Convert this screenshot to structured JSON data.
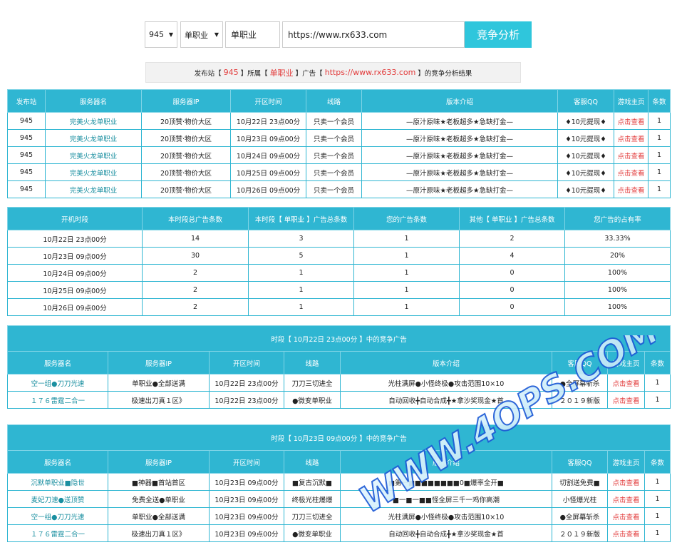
{
  "search": {
    "site_select": "945",
    "type_select": "单职业",
    "keyword": "单职业",
    "url": "https://www.rx633.com",
    "button": "竞争分析"
  },
  "summary": {
    "p1": "发布站【",
    "site": "945",
    "p2": "】所属【",
    "type": "单职业",
    "p3": "】广告【",
    "url": "https://www.rx633.com",
    "p4": "】的竞争分析结果"
  },
  "table1": {
    "headers": [
      "发布站",
      "服务器名",
      "服务器IP",
      "开区时间",
      "线路",
      "版本介绍",
      "客服QQ",
      "游戏主页",
      "条数"
    ],
    "rows": [
      [
        "945",
        "完美火龙单职业",
        "20顶赞·物价大区",
        "10月22日 23点00分",
        "只卖一个会员",
        "—原汁原味★老板超多★急缺打金—",
        "♦10元提现♦",
        "点击查看",
        "1"
      ],
      [
        "945",
        "完美火龙单职业",
        "20顶赞·物价大区",
        "10月23日 09点00分",
        "只卖一个会员",
        "—原汁原味★老板超多★急缺打金—",
        "♦10元提现♦",
        "点击查看",
        "1"
      ],
      [
        "945",
        "完美火龙单职业",
        "20顶赞·物价大区",
        "10月24日 09点00分",
        "只卖一个会员",
        "—原汁原味★老板超多★急缺打金—",
        "♦10元提现♦",
        "点击查看",
        "1"
      ],
      [
        "945",
        "完美火龙单职业",
        "20顶赞·物价大区",
        "10月25日 09点00分",
        "只卖一个会员",
        "—原汁原味★老板超多★急缺打金—",
        "♦10元提现♦",
        "点击查看",
        "1"
      ],
      [
        "945",
        "完美火龙单职业",
        "20顶赞·物价大区",
        "10月26日 09点00分",
        "只卖一个会员",
        "—原汁原味★老板超多★急缺打金—",
        "♦10元提现♦",
        "点击查看",
        "1"
      ]
    ]
  },
  "table2": {
    "headers": [
      "开机时段",
      "本时段总广告条数",
      "本时段【 单职业 】广告总条数",
      "您的广告条数",
      "其他【 单职业 】广告总条数",
      "您广告的占有率"
    ],
    "rows": [
      [
        "10月22日 23点00分",
        "14",
        "3",
        "1",
        "2",
        "33.33%"
      ],
      [
        "10月23日 09点00分",
        "30",
        "5",
        "1",
        "4",
        "20%"
      ],
      [
        "10月24日 09点00分",
        "2",
        "1",
        "1",
        "0",
        "100%"
      ],
      [
        "10月25日 09点00分",
        "2",
        "1",
        "1",
        "0",
        "100%"
      ],
      [
        "10月26日 09点00分",
        "2",
        "1",
        "1",
        "0",
        "100%"
      ]
    ]
  },
  "table3": {
    "title": "时段【 10月22日 23点00分 】中的竞争广告",
    "headers": [
      "服务器名",
      "服务器IP",
      "开区时间",
      "线路",
      "版本介绍",
      "客服QQ",
      "游戏主页",
      "条数"
    ],
    "rows": [
      [
        "空一组●刀刀光速",
        "单职业●全部送满",
        "10月22日 23点00分",
        "刀刀三切进全",
        "光柱满屏●小怪终极●攻击范围10×10",
        "●全屏幕斩杀",
        "点击查看",
        "1"
      ],
      [
        "１７６雷霆二合一",
        "极速出刀真１区》",
        "10月22日 23点00分",
        "●微变单职业",
        "自动回收╋自动合成╋★拿沙奖现金★首",
        "２０１９新版",
        "点击查看",
        "1"
      ]
    ]
  },
  "table4": {
    "title": "时段【 10月23日 09点00分 】中的竞争广告",
    "headers": [
      "服务器名",
      "服务器IP",
      "开区时间",
      "线路",
      "版本介绍",
      "客服QQ",
      "游戏主页",
      "条数"
    ],
    "rows": [
      [
        "沉默单职业■隐世",
        "■神器■首站首区",
        "10月23日 09点00分",
        "■复古沉默■",
        "■第一■■■■■■■■0■爆率全开■",
        "切割送免费■",
        "点击查看",
        "1"
      ],
      [
        "麦妃刀速●送顶赞",
        "免费全送●单职业",
        "10月23日 09点00分",
        "终极光柱爆爆",
        "■一■一■■怪全屏三千一鸡你高潮",
        "小怪爆光柱",
        "点击查看",
        "1"
      ],
      [
        "空一组●刀刀光速",
        "单职业●全部送满",
        "10月23日 09点00分",
        "刀刀三切进全",
        "光柱满屏●小怪终极●攻击范围10×10",
        "●全屏幕斩杀",
        "点击查看",
        "1"
      ],
      [
        "１７６雷霆二合一",
        "极速出刀真１区》",
        "10月23日 09点00分",
        "●微变单职业",
        "自动回收╋自动合成╋★拿沙奖现金★首",
        "２０１９新版",
        "点击查看",
        "1"
      ]
    ]
  },
  "watermark": "WWW.4OPS.COM",
  "colors": {
    "header_bg": "#2fb6d2",
    "button_bg": "#2fc6dc",
    "link_teal": "#1a8fa0",
    "link_red": "#e23b3b"
  }
}
